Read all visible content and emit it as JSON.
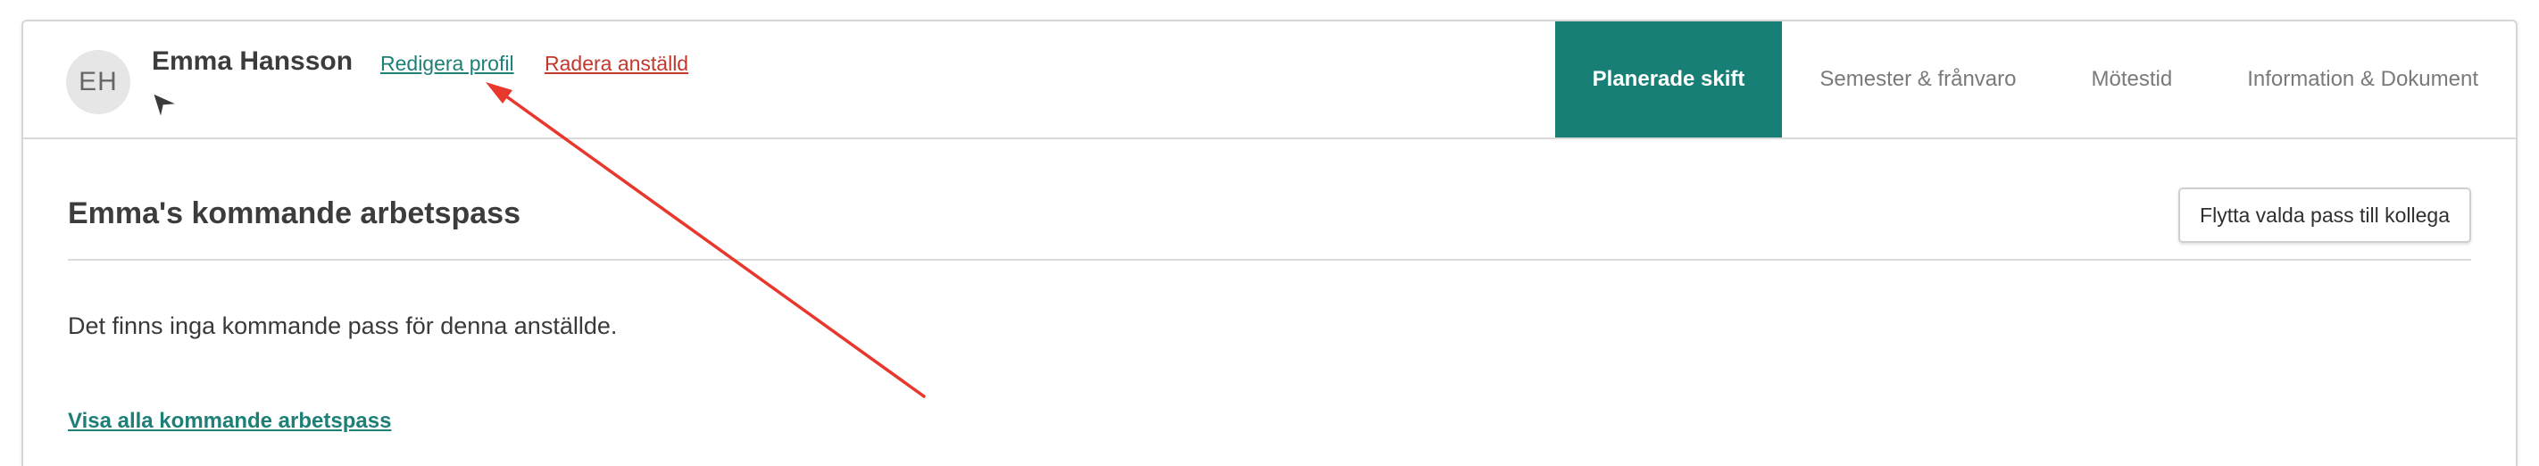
{
  "profile": {
    "initials": "EH",
    "name": "Emma Hansson",
    "edit_label": "Redigera profil",
    "delete_label": "Radera anställd",
    "message_icon": "send-icon"
  },
  "tabs": [
    {
      "label": "Planerade skift",
      "active": true
    },
    {
      "label": "Semester & frånvaro",
      "active": false
    },
    {
      "label": "Mötestid",
      "active": false
    },
    {
      "label": "Information & Dokument",
      "active": false
    }
  ],
  "main": {
    "title": "Emma's kommande arbetspass",
    "move_button_label": "Flytta valda pass till kollega",
    "empty_message": "Det finns inga kommande pass för denna anställde.",
    "show_all_label": "Visa alla kommande arbetspass"
  },
  "colors": {
    "accent": "#177f75",
    "link": "#1e7f77",
    "danger": "#c0392b",
    "annotation": "#e8372c"
  }
}
